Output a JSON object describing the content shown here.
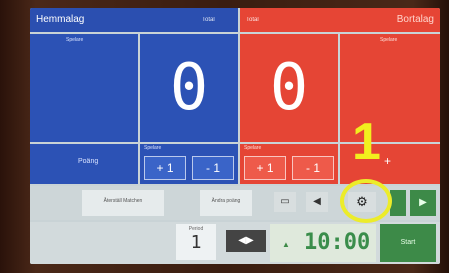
{
  "home": {
    "name": "Hemmalag",
    "header_tag": "Total",
    "panel_label": "Spelare",
    "score": "0",
    "minus_label": "- 1",
    "plus_label": "+ 1",
    "small_label": "Spelare",
    "score_label": "Poäng"
  },
  "away": {
    "name": "Bortalag",
    "header_tag": "Total",
    "panel_label": "Spelare",
    "score": "0",
    "minus_label": "- 1",
    "plus_label": "+ 1",
    "small_label": "Spelare",
    "add_label": "+"
  },
  "bottom": {
    "left_btn": "Återställ Matchen",
    "mid_btn": "Ändra poäng",
    "period_label": "Period",
    "period_value": "1",
    "time": "10:00",
    "start_label": "Start"
  },
  "annotation": {
    "callout": "1",
    "color": "#ecec2a"
  },
  "colors": {
    "home": "#2c52b5",
    "away": "#e54535",
    "green": "#3d8a48"
  }
}
